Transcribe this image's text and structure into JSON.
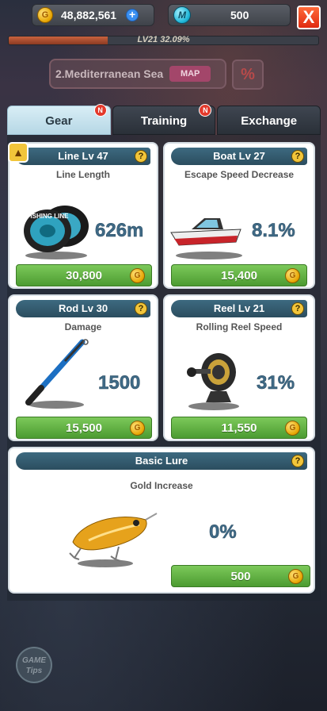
{
  "currency": {
    "gold": "48,882,561",
    "gem": "500",
    "gold_icon": "coin-icon",
    "gem_icon": "gem-icon",
    "gold_icon_glyph": "G",
    "gem_icon_glyph": "M",
    "plus_glyph": "+",
    "close_glyph": "X"
  },
  "level": {
    "text": "LV21 32.09%",
    "progress": 0.3209
  },
  "location": {
    "name": "2.Mediterranean Sea",
    "map_label": "MAP",
    "percent_glyph": "%"
  },
  "tabs": [
    {
      "label": "Gear",
      "active": true,
      "badge": "N"
    },
    {
      "label": "Training",
      "active": false,
      "badge": "N"
    },
    {
      "label": "Exchange",
      "active": false,
      "badge": ""
    }
  ],
  "cards": {
    "line": {
      "title": "Line Lv 47",
      "stat": "Line Length",
      "value": "626m",
      "price": "30,800",
      "spool_text": "FISHING LINE"
    },
    "boat": {
      "title": "Boat Lv 27",
      "stat": "Escape Speed Decrease",
      "value": "8.1%",
      "price": "15,400"
    },
    "rod": {
      "title": "Rod Lv 30",
      "stat": "Damage",
      "value": "1500",
      "price": "15,500"
    },
    "reel": {
      "title": "Reel Lv 21",
      "stat": "Rolling Reel Speed",
      "value": "31%",
      "price": "11,550"
    },
    "lure": {
      "title": "Basic Lure",
      "stat": "Gold Increase",
      "value": "0%",
      "price": "500"
    }
  },
  "help_glyph": "?",
  "coin_glyph": "G",
  "game_tips": "GAME Tips",
  "colors": {
    "accent_green": "#5fb043",
    "header_teal": "#2b4d5f",
    "value_blue": "#3f6a86",
    "close_red": "#e02a10",
    "badge_red": "#e33a2c"
  }
}
